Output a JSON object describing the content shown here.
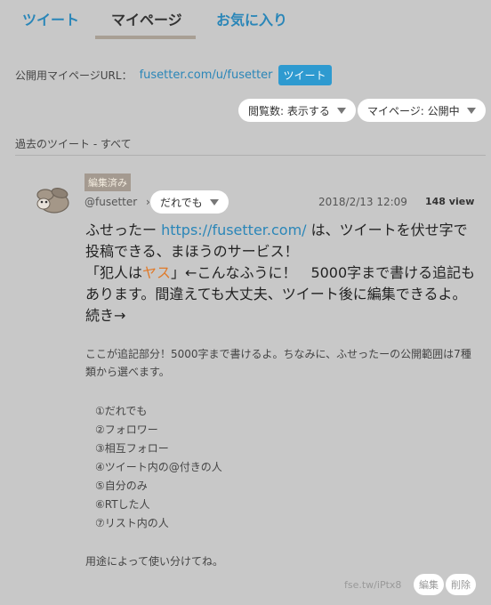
{
  "tabs": [
    {
      "label": "ツイート",
      "active": false
    },
    {
      "label": "マイページ",
      "active": true
    },
    {
      "label": "お気に入り",
      "active": false
    }
  ],
  "url_row": {
    "label": "公開用マイページURL：",
    "link": "fusetter.com/u/fusetter",
    "tweet_button": "ツイート"
  },
  "settings": {
    "views_dropdown": "閲覧数: 表示する",
    "mypage_dropdown": "マイページ: 公開中"
  },
  "section_title": "過去のツイート - すべて",
  "post": {
    "edited_badge": "編集済み",
    "username": "@fusetter",
    "separator": "›",
    "audience": "だれでも",
    "date": "2018/2/13 12:09",
    "views": "148 view",
    "body": {
      "part1": "ふせったー ",
      "link": "https://fusetter.com/",
      "part2": " は、ツイートを伏せ字で投稿できる、まほうのサービス！",
      "part3": "「犯人は",
      "highlight": "ヤス",
      "part4": "」←こんなふうに！　5000字まで書ける追記もあります。間違えても大丈夫、ツイート後に編集できるよ。続き→"
    },
    "addendum": "ここが追記部分！5000字まで書けるよ。ちなみに、ふせったーの公開範囲は7種類から選べます。",
    "list": [
      "①だれでも",
      "②フォロワー",
      "③相互フォロー",
      "④ツイート内の@付きの人",
      "⑤自分のみ",
      "⑥RTした人",
      "⑦リスト内の人"
    ],
    "closing": "用途によって使い分けてね。",
    "short_link": "fse.tw/iPtx8",
    "edit_button": "編集",
    "delete_button": "削除"
  },
  "colors": {
    "background": "#c8c8c8",
    "accent_blue": "#2a86b8",
    "tweet_button": "#2e9ad0",
    "highlight_orange": "#e07a2a",
    "badge": "#a49a90"
  }
}
